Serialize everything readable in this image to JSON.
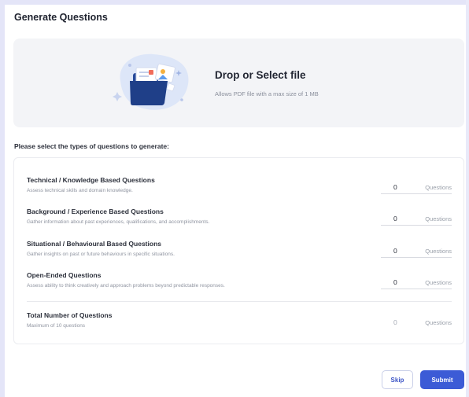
{
  "page": {
    "title": "Generate Questions"
  },
  "upload": {
    "title": "Drop or Select file",
    "subtitle": "Allows PDF file with a max size of 1 MB",
    "illustration_icon": "folder-upload-icon"
  },
  "prompt": "Please select the types of questions to generate:",
  "question_types": [
    {
      "title": "Technical / Knowledge Based Questions",
      "description": "Assess technical skills and domain knowledge.",
      "count": "0",
      "unit": "Questions"
    },
    {
      "title": "Background / Experience Based Questions",
      "description": "Gather information about past experiences, qualifications, and accomplishments.",
      "count": "0",
      "unit": "Questions"
    },
    {
      "title": "Situational / Behavioural Based Questions",
      "description": "Gather insights on past or future behaviours in specific situations.",
      "count": "0",
      "unit": "Questions"
    },
    {
      "title": "Open-Ended Questions",
      "description": "Assess ability to think creatively and approach problems beyond predictable responses.",
      "count": "0",
      "unit": "Questions"
    }
  ],
  "total": {
    "title": "Total Number of Questions",
    "description": "Maximum of 10 questions",
    "count": "0",
    "unit": "Questions"
  },
  "actions": {
    "skip": "Skip",
    "submit": "Submit"
  },
  "colors": {
    "accent": "#3c5bd6",
    "frame": "#e4e5f8",
    "dropzone_bg": "#f3f4f7",
    "illustration_blob": "#dde6f8",
    "folder": "#1f3f88"
  }
}
